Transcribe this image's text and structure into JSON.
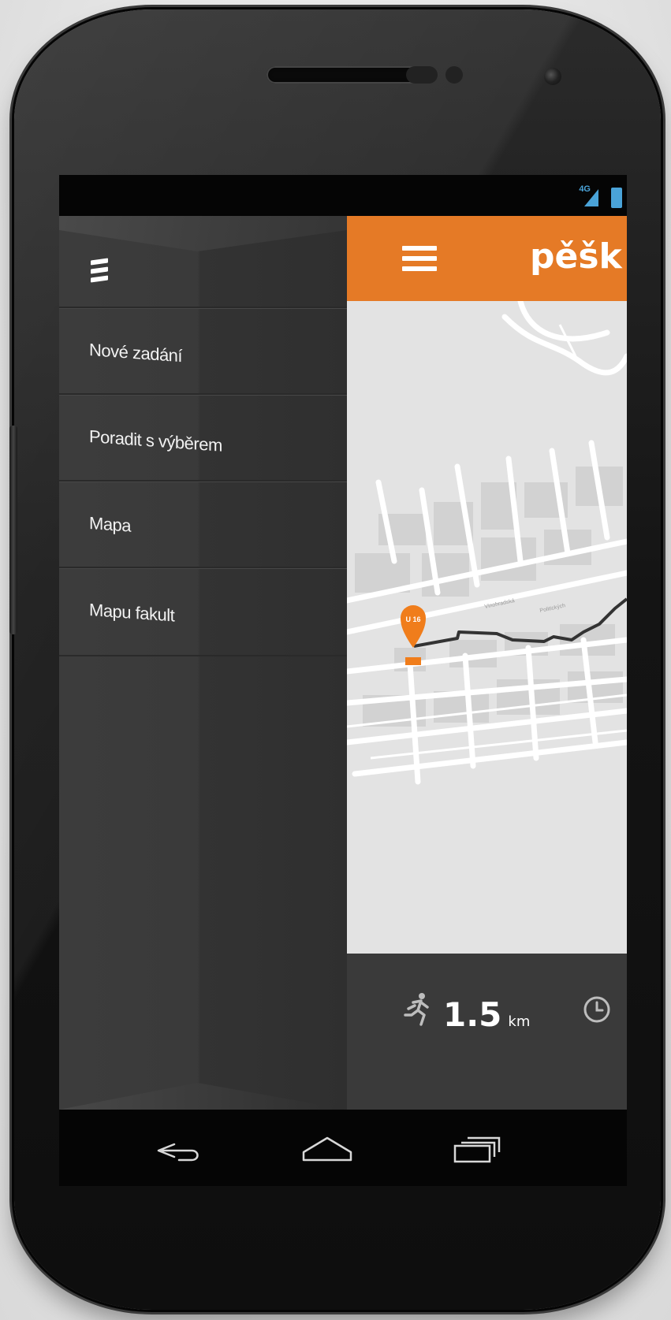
{
  "status_bar": {
    "network": "4G"
  },
  "drawer": {
    "items": [
      {
        "label": "Nové zadání"
      },
      {
        "label": "Poradit s výběrem"
      },
      {
        "label": "Mapa"
      },
      {
        "label": "Mapu fakult"
      }
    ]
  },
  "app_bar": {
    "title": "pěšk",
    "accent_color": "#e57a26"
  },
  "map": {
    "marker": {
      "label": "U 16",
      "color": "#f07d1b"
    },
    "street_labels": [
      "Vinohradská",
      "Politických"
    ]
  },
  "bottom_bar": {
    "distance_value": "1.5",
    "distance_unit": "km",
    "icons": [
      "runner-icon",
      "clock-icon"
    ]
  },
  "nav_bar": {
    "icons": [
      "back-icon",
      "home-icon",
      "recent-apps-icon"
    ]
  }
}
